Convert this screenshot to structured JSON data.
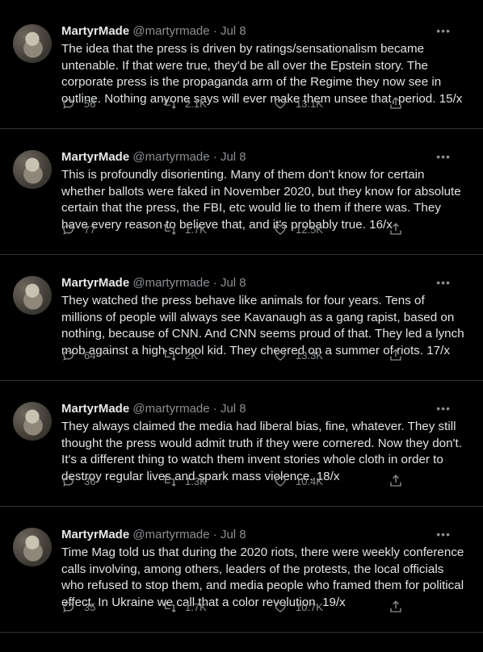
{
  "tweets": [
    {
      "name": "MartyrMade",
      "handle": "@martyrmade",
      "separator": "·",
      "date": "Jul 8",
      "text": "The idea that the press is driven by ratings/sensationalism became untenable. If that were true, they'd be all over the Epstein story. The corporate press is the propaganda arm of the Regime they now see in outline. Nothing anyone says will ever make them unsee that, period. 15/x",
      "replies": "56",
      "retweets": "2.1K",
      "likes": "13.1K"
    },
    {
      "name": "MartyrMade",
      "handle": "@martyrmade",
      "separator": "·",
      "date": "Jul 8",
      "text": "This is profoundly disorienting. Many of them don't know for certain whether ballots were faked in November 2020, but they know for absolute certain that the press, the FBI, etc would lie to them if there was. They have every reason to believe that, and it's probably true. 16/x",
      "replies": "77",
      "retweets": "1.7K",
      "likes": "12.5K"
    },
    {
      "name": "MartyrMade",
      "handle": "@martyrmade",
      "separator": "·",
      "date": "Jul 8",
      "text": "They watched the press behave like animals for four years. Tens of millions of people will always see Kavanaugh as a gang rapist, based on nothing, because of CNN. And CNN seems proud of that. They led a lynch mob against a high school kid. They cheered on a summer of riots. 17/x",
      "replies": "64",
      "retweets": "2K",
      "likes": "13.3K"
    },
    {
      "name": "MartyrMade",
      "handle": "@martyrmade",
      "separator": "·",
      "date": "Jul 8",
      "text": "They always claimed the media had liberal bias, fine, whatever. They still thought the press would admit truth if they were cornered. Now they don't. It's a different thing to watch them invent stories whole cloth in order to destroy regular lives and spark mass violence. 18/x",
      "replies": "36",
      "retweets": "1.3K",
      "likes": "10.4K"
    },
    {
      "name": "MartyrMade",
      "handle": "@martyrmade",
      "separator": "·",
      "date": "Jul 8",
      "text": "Time Mag told us that during the 2020 riots, there were weekly conference calls involving, among others, leaders of the protests, the local officials who refused to stop them, and media people who framed them for political effect. In Ukraine we call that a color revolution. 19/x",
      "replies": "35",
      "retweets": "1.7K",
      "likes": "10.7K"
    }
  ],
  "more_glyph": "•••",
  "icons": [
    "reply-icon",
    "retweet-icon",
    "like-icon",
    "share-icon",
    "more-icon"
  ]
}
